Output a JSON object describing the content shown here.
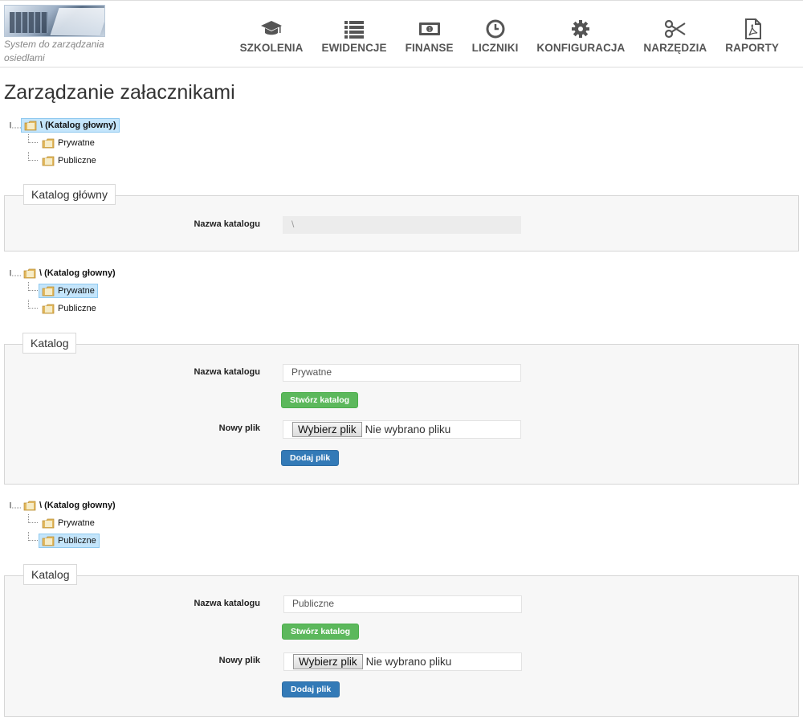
{
  "header": {
    "logo_text": "System do zarządzania osiedlami",
    "nav": [
      {
        "label": "SZKOLENIA",
        "icon": "graduation-cap-icon"
      },
      {
        "label": "EWIDENCJE",
        "icon": "list-icon"
      },
      {
        "label": "FINANSE",
        "icon": "money-icon"
      },
      {
        "label": "LICZNIKI",
        "icon": "clock-icon"
      },
      {
        "label": "KONFIGURACJA",
        "icon": "gear-icon"
      },
      {
        "label": "NARZĘDZIA",
        "icon": "scissors-icon"
      },
      {
        "label": "RAPORTY",
        "icon": "pdf-file-icon"
      }
    ]
  },
  "page": {
    "title": "Zarządzanie załacznikami"
  },
  "trees": [
    {
      "root": "\\ (Katalog głowny)",
      "children": [
        "Prywatne",
        "Publiczne"
      ],
      "selected": "root"
    },
    {
      "root": "\\ (Katalog głowny)",
      "children": [
        "Prywatne",
        "Publiczne"
      ],
      "selected": "Prywatne"
    },
    {
      "root": "\\ (Katalog głowny)",
      "children": [
        "Prywatne",
        "Publiczne"
      ],
      "selected": "Publiczne"
    }
  ],
  "panels": [
    {
      "legend": "Katalog główny",
      "name_label": "Nazwa katalogu",
      "name_value": "\\"
    },
    {
      "legend": "Katalog",
      "name_label": "Nazwa katalogu",
      "name_value": "Prywatne",
      "create_button": "Stwórz katalog",
      "file_label": "Nowy plik",
      "file_button": "Wybierz plik",
      "file_status": "Nie wybrano pliku",
      "add_button": "Dodaj plik"
    },
    {
      "legend": "Katalog",
      "name_label": "Nazwa katalogu",
      "name_value": "Publiczne",
      "create_button": "Stwórz katalog",
      "file_label": "Nowy plik",
      "file_button": "Wybierz plik",
      "file_status": "Nie wybrano pliku",
      "add_button": "Dodaj plik"
    }
  ],
  "colors": {
    "nav_icon": "#555555",
    "selected_bg": "#c4e5fb",
    "green_button": "#5cb85c",
    "blue_button": "#337ab7"
  }
}
